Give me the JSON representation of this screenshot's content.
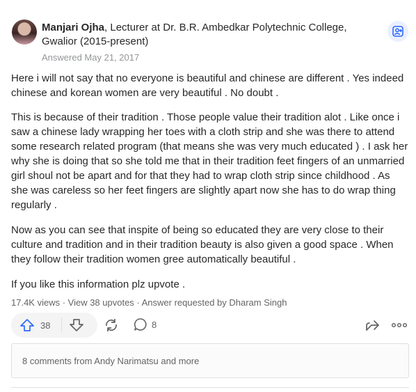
{
  "answer": {
    "author_name": "Manjari Ojha",
    "author_credential": ", Lecturer at Dr. B.R. Ambedkar Polytechnic College, Gwalior (2015-present)",
    "answered_date": "Answered May 21, 2017",
    "paragraphs": [
      "Here i will not say that no everyone is beautiful and chinese are different . Yes indeed chinese and korean women are very beautiful . No doubt .",
      "This is because of their tradition . Those people value their tradition alot . Like once i saw a chinese lady wrapping her toes with a cloth strip and she was there to attend some research related program (that means she was very much educated ) . I ask her why she is doing that so she told me that in their tradition feet fingers of an unmarried girl shoul not be apart and for that they had to wrap cloth strip since childhood . As she was careless so her feet fingers are slightly apart now she has to do wrap thing regularly .",
      "Now as you can see that inspite of being so educated they are very close to their culture and tradition and in their tradition beauty is also given a good space . When they follow their tradition women gree automatically beautiful .",
      "If you like this information plz upvote ."
    ],
    "stats": "17.4K views · View 38 upvotes · Answer requested by Dharam Singh",
    "upvote_count": "38",
    "comment_count": "8",
    "comments_preview": "8 comments from Andy Narimatsu and more"
  },
  "icons": {
    "follow": "add-person-icon",
    "upvote": "arrow-up-icon",
    "downvote": "arrow-down-icon",
    "share": "share-cycle-icon",
    "comment": "comment-bubble-icon",
    "repost": "repost-arrow-icon",
    "more": "more-dots-icon"
  },
  "colors": {
    "accent": "#2e69ff",
    "accent_bg": "#ebf0ff",
    "text": "#282829",
    "muted": "#939598",
    "secondary": "#636466"
  }
}
